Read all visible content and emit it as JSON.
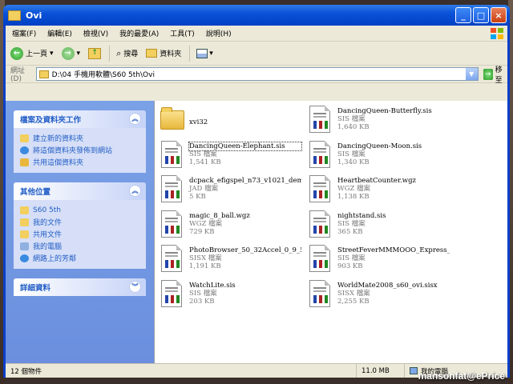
{
  "window": {
    "title": "Ovi"
  },
  "menu": [
    "檔案(F)",
    "編輯(E)",
    "檢視(V)",
    "我的最愛(A)",
    "工具(T)",
    "說明(H)"
  ],
  "toolbar": {
    "back": "上一頁",
    "search": "搜尋",
    "folders": "資料夾"
  },
  "address": {
    "label": "網址(D)",
    "path": "D:\\04 手機用軟體\\S60 5th\\Ovi",
    "go": "移至"
  },
  "sidebar": {
    "tasks": {
      "title": "檔案及資料夾工作",
      "items": [
        "建立新的資料夾",
        "將這個資料夾發佈到網站",
        "共用這個資料夾"
      ]
    },
    "places": {
      "title": "其他位置",
      "items": [
        "S60 5th",
        "我的文件",
        "共用文件",
        "我的電腦",
        "網路上的芳鄰"
      ]
    },
    "details": {
      "title": "詳細資料"
    }
  },
  "files": [
    {
      "name": "xvi32",
      "type": "",
      "size": "",
      "kind": "folder"
    },
    {
      "name": "DancingQueen-Butterfly.sis",
      "type": "SIS 檔案",
      "size": "1,640 KB",
      "kind": "doc"
    },
    {
      "name": "DancingQueen-Elephant.sis",
      "type": "SIS 檔案",
      "size": "1,541 KB",
      "kind": "doc"
    },
    {
      "name": "DancingQueen-Moon.sis",
      "type": "SIS 檔案",
      "size": "1,340 KB",
      "kind": "doc"
    },
    {
      "name": "dcpack_efigspel_n73_v1021_demo...",
      "type": "JAD 檔案",
      "size": "5 KB",
      "kind": "doc"
    },
    {
      "name": "HeartbeatCounter.wgz",
      "type": "WGZ 檔案",
      "size": "1,138 KB",
      "kind": "doc"
    },
    {
      "name": "magic_8_ball.wgz",
      "type": "WGZ 檔案",
      "size": "729 KB",
      "kind": "doc"
    },
    {
      "name": "nightstand.sis",
      "type": "SIS 檔案",
      "size": "365 KB",
      "kind": "doc"
    },
    {
      "name": "PhotoBrowser_50_32Accel_0_9_5....",
      "type": "SISX 檔案",
      "size": "1,191 KB",
      "kind": "doc"
    },
    {
      "name": "StreetFeverMMMOOO_Express_Sig...",
      "type": "SIS 檔案",
      "size": "903 KB",
      "kind": "doc"
    },
    {
      "name": "WatchLite.sis",
      "type": "SIS 檔案",
      "size": "203 KB",
      "kind": "doc"
    },
    {
      "name": "WorldMate2008_s60_ovi.sisx",
      "type": "SISX 檔案",
      "size": "2,255 KB",
      "kind": "doc"
    }
  ],
  "status": {
    "count": "12 個物件",
    "size": "11.0 MB",
    "location": "我的電腦"
  },
  "watermark": "mansonfat@ePrice"
}
